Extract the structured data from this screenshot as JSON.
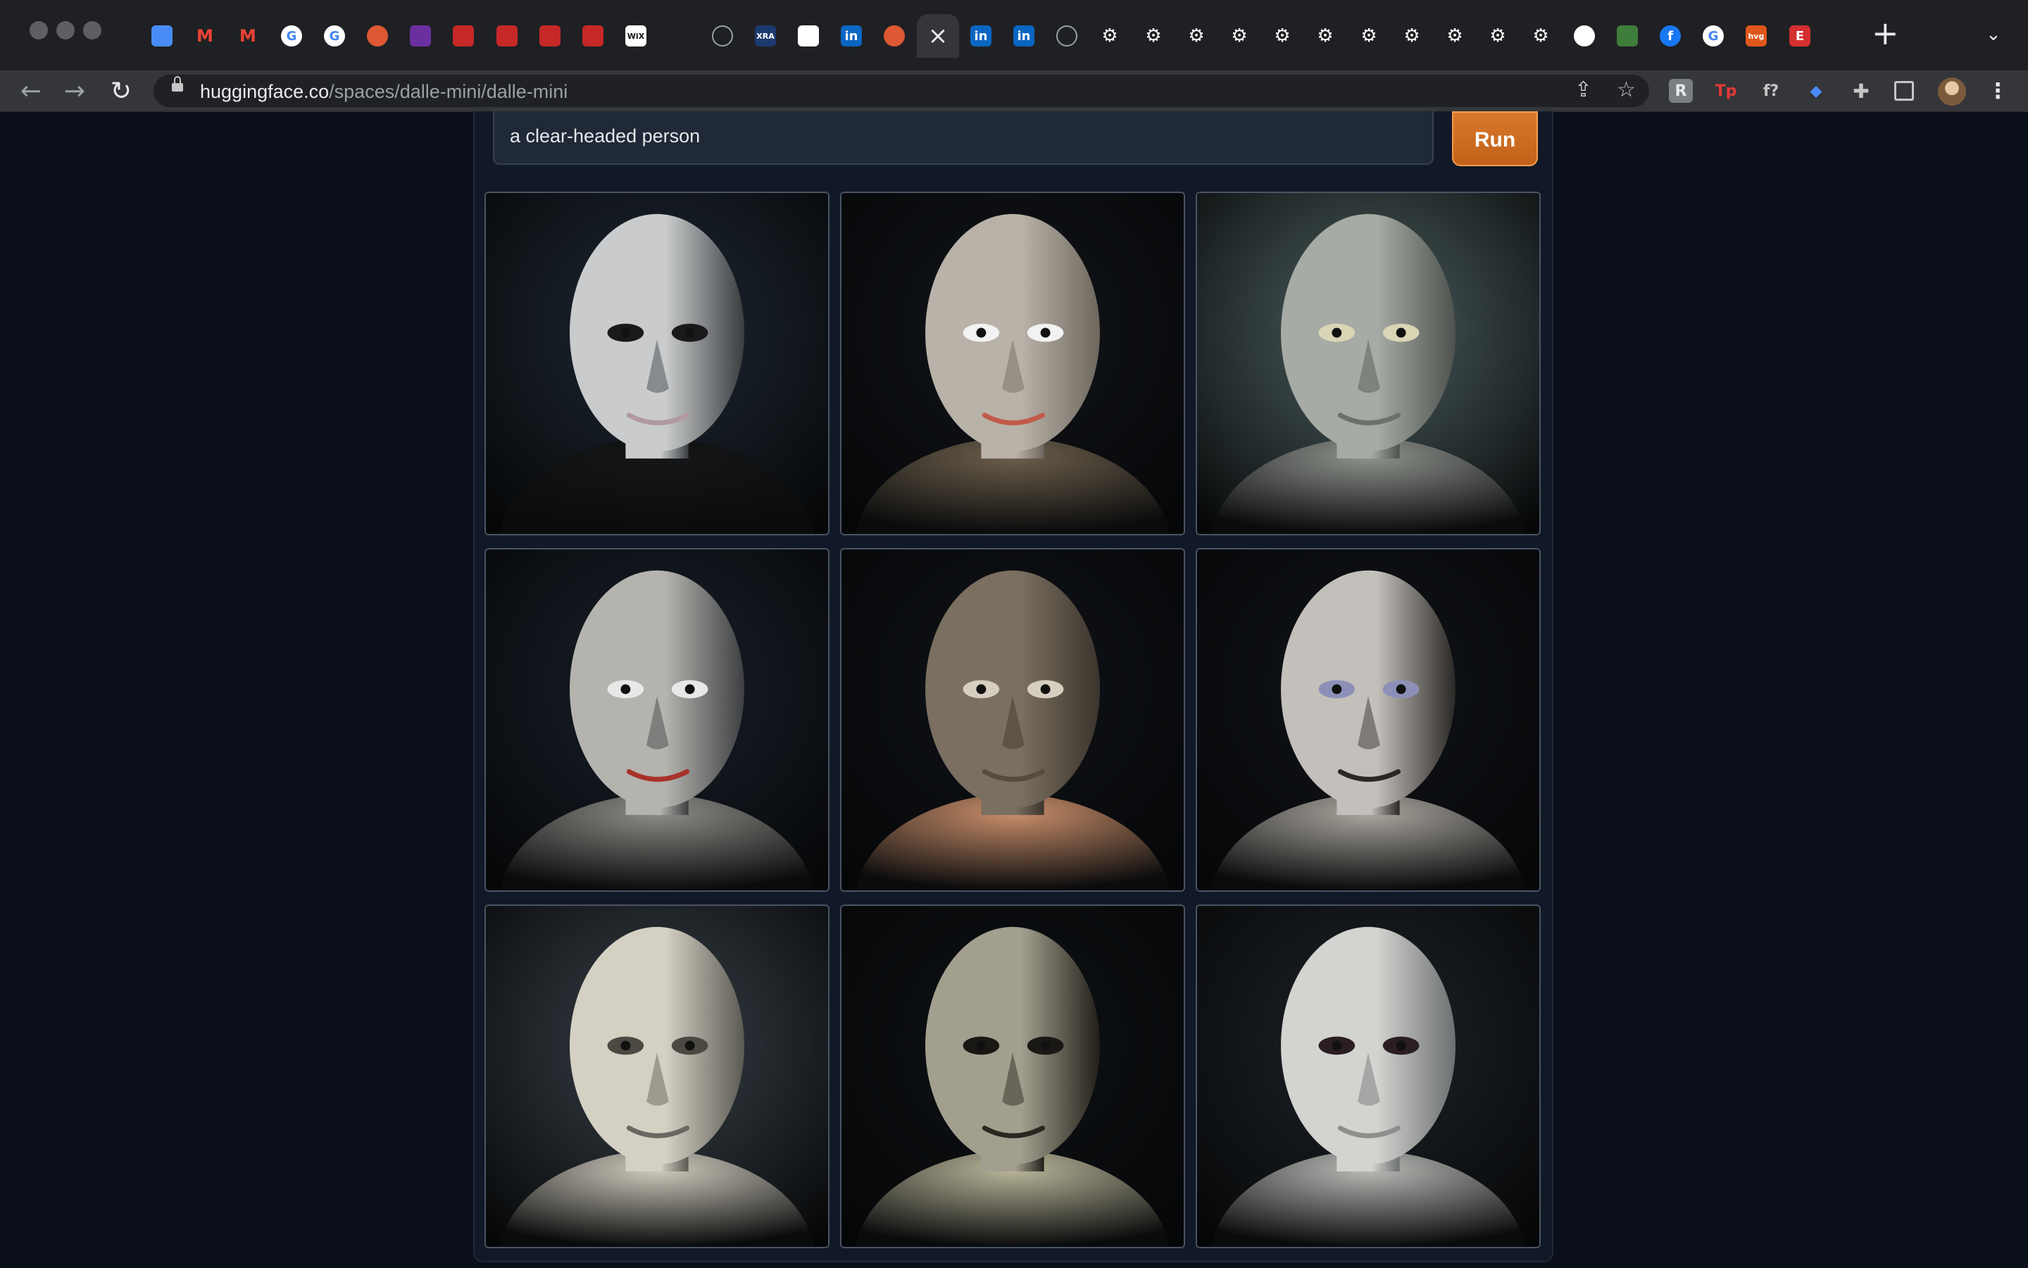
{
  "browser": {
    "url_host": "huggingface.co",
    "url_path": "/spaces/dalle-mini/dalle-mini",
    "tabs": [
      {
        "icon": "gem-icon",
        "favicon_text": "",
        "color": "#4a8cf7"
      },
      {
        "icon": "gmail-icon",
        "favicon_text": "M",
        "color": "#ea4335"
      },
      {
        "icon": "gmail-icon",
        "favicon_text": "M",
        "color": "#ea4335"
      },
      {
        "icon": "google-icon",
        "favicon_text": "G",
        "color": "#ffffff"
      },
      {
        "icon": "google-icon",
        "favicon_text": "G",
        "color": "#ffffff"
      },
      {
        "icon": "duckduckgo-icon",
        "favicon_text": "",
        "color": "#de5833"
      },
      {
        "icon": "purple-app-icon",
        "favicon_text": "",
        "color": "#6b2fa0"
      },
      {
        "icon": "red-pin-icon",
        "favicon_text": "",
        "color": "#c62828"
      },
      {
        "icon": "red-pin-icon",
        "favicon_text": "",
        "color": "#c62828"
      },
      {
        "icon": "red-pin-icon",
        "favicon_text": "",
        "color": "#c62828"
      },
      {
        "icon": "red-pin-icon",
        "favicon_text": "",
        "color": "#c62828"
      },
      {
        "icon": "wix-icon",
        "favicon_text": "WiX",
        "color": "#ffffff"
      },
      {
        "icon": "blank-icon",
        "favicon_text": "",
        "color": "#1f2023"
      },
      {
        "icon": "globe-icon",
        "favicon_text": "",
        "color": "#9aa0a6"
      },
      {
        "icon": "xra-icon",
        "favicon_text": "XRA",
        "color": "#1c3a6e"
      },
      {
        "icon": "white-square-icon",
        "favicon_text": "",
        "color": "#ffffff"
      },
      {
        "icon": "linkedin-icon",
        "favicon_text": "in",
        "color": "#0a66c2"
      },
      {
        "icon": "duckduckgo-icon",
        "favicon_text": "",
        "color": "#de5833"
      },
      {
        "icon": "close-icon",
        "favicon_text": "",
        "color": "#e8eaed"
      },
      {
        "icon": "linkedin-icon",
        "favicon_text": "in",
        "color": "#0a66c2"
      },
      {
        "icon": "linkedin-icon",
        "favicon_text": "in",
        "color": "#0a66c2"
      },
      {
        "icon": "globe-icon",
        "favicon_text": "",
        "color": "#9aa0a6"
      },
      {
        "icon": "gear-icon",
        "favicon_text": "",
        "color": "#ffffff"
      },
      {
        "icon": "gear-icon",
        "favicon_text": "",
        "color": "#ffffff"
      },
      {
        "icon": "gear-icon",
        "favicon_text": "",
        "color": "#ffffff"
      },
      {
        "icon": "gear-icon",
        "favicon_text": "",
        "color": "#ffffff"
      },
      {
        "icon": "gear-icon",
        "favicon_text": "",
        "color": "#ffffff"
      },
      {
        "icon": "gear-icon",
        "favicon_text": "",
        "color": "#ffffff"
      },
      {
        "icon": "gear-icon",
        "favicon_text": "",
        "color": "#ffffff"
      },
      {
        "icon": "gear-icon",
        "favicon_text": "",
        "color": "#ffffff"
      },
      {
        "icon": "gear-icon",
        "favicon_text": "",
        "color": "#ffffff"
      },
      {
        "icon": "gear-icon",
        "favicon_text": "",
        "color": "#ffffff"
      },
      {
        "icon": "gear-icon",
        "favicon_text": "",
        "color": "#ffffff"
      },
      {
        "icon": "github-icon",
        "favicon_text": "",
        "color": "#ffffff"
      },
      {
        "icon": "green-app-icon",
        "favicon_text": "",
        "color": "#3f7d3a"
      },
      {
        "icon": "facebook-icon",
        "favicon_text": "f",
        "color": "#1877f2"
      },
      {
        "icon": "google-icon",
        "favicon_text": "G",
        "color": "#ffffff"
      },
      {
        "icon": "hvg-icon",
        "favicon_text": "hvg",
        "color": "#e0561b"
      },
      {
        "icon": "e-icon",
        "favicon_text": "E",
        "color": "#d32f2f"
      }
    ],
    "extensions": [
      {
        "icon": "ext-r-icon",
        "text": "R",
        "color": "#7a7d82"
      },
      {
        "icon": "ext-tp-icon",
        "text": "Tp",
        "color": "#e53935"
      },
      {
        "icon": "ext-f-icon",
        "text": "f?",
        "color": "#c4c7c5"
      },
      {
        "icon": "gem-icon",
        "text": "",
        "color": "#4a8cf7"
      },
      {
        "icon": "puzzle-icon",
        "text": "",
        "color": "#c4c7c5"
      },
      {
        "icon": "side-panel-icon",
        "text": "",
        "color": "#c4c7c5"
      }
    ]
  },
  "app": {
    "prompt_value": "a clear-headed person",
    "run_label": "Run"
  },
  "gallery": {
    "images": [
      {
        "bg": "#202a33",
        "face": "#c9cbcc",
        "shadow": "#3a3d40",
        "eyes": "#1a1a1c",
        "body": "#151617",
        "mouth": "#b09aa0"
      },
      {
        "bg": "#111315",
        "face": "#b8b2a8",
        "shadow": "#6e675e",
        "eyes": "#f2f2f2",
        "body": "#6b5e4b",
        "mouth": "#c25a4a"
      },
      {
        "bg": "#5a6e6a",
        "face": "#a7aba5",
        "shadow": "#4d524e",
        "eyes": "#d9d5b5",
        "body": "#8e928c",
        "mouth": "#6d706b"
      },
      {
        "bg": "#1a2028",
        "face": "#b4b3ae",
        "shadow": "#3d3f42",
        "eyes": "#e8e8e8",
        "body": "#8c8b86",
        "mouth": "#a8322a"
      },
      {
        "bg": "#0f1113",
        "face": "#7a6f60",
        "shadow": "#3b342c",
        "eyes": "#d6cfc0",
        "body": "#c98e6a",
        "mouth": "#574b3e"
      },
      {
        "bg": "#101214",
        "face": "#c3bfba",
        "shadow": "#2a2826",
        "eyes": "#8c90b8",
        "body": "#aaa69f",
        "mouth": "#2a2826"
      },
      {
        "bg": "#3f474c",
        "face": "#d4d0c4",
        "shadow": "#5b5a52",
        "eyes": "#4b4942",
        "body": "#cfcabd",
        "mouth": "#6a6860"
      },
      {
        "bg": "#0d0f0f",
        "face": "#a39f8f",
        "shadow": "#221f19",
        "eyes": "#1a1814",
        "body": "#b9b69a",
        "mouth": "#2a2620"
      },
      {
        "bg": "#202426",
        "face": "#d3d4d0",
        "shadow": "#6c6f70",
        "eyes": "#2a1e22",
        "body": "#b8bab6",
        "mouth": "#8e8f8c"
      }
    ]
  }
}
